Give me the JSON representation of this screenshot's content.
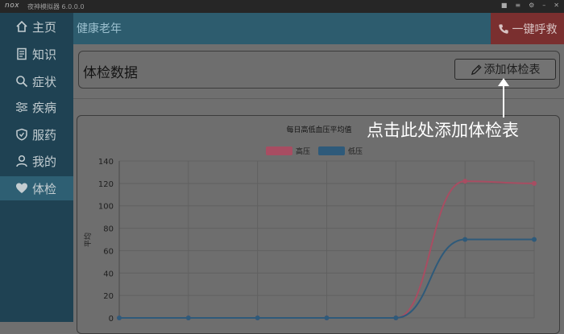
{
  "window": {
    "logo": "nox",
    "title": "夜神模拟器 6.0.0.0"
  },
  "sidebar": {
    "items": [
      {
        "label": "主页",
        "icon": "home-icon"
      },
      {
        "label": "知识",
        "icon": "document-icon"
      },
      {
        "label": "症状",
        "icon": "search-icon"
      },
      {
        "label": "疾病",
        "icon": "sliders-icon"
      },
      {
        "label": "服药",
        "icon": "shield-icon"
      },
      {
        "label": "我的",
        "icon": "user-icon"
      },
      {
        "label": "体检",
        "icon": "heart-icon"
      }
    ],
    "active_index": 6
  },
  "header": {
    "title": "健康老年",
    "sos_label": "一键呼救"
  },
  "panel": {
    "title": "体检数据",
    "add_button": "添加体检表"
  },
  "callout": {
    "text": "点击此处添加体检表"
  },
  "colors": {
    "high": "#a84d62",
    "low": "#2e5a7a",
    "sidebar": "#1f4253",
    "header": "#2d5c6e",
    "sos": "#7a2f2f"
  },
  "chart_data": {
    "type": "line",
    "title": "每日高低血压平均值",
    "ylabel": "平均",
    "ylim": [
      0,
      140
    ],
    "yticks": [
      0,
      20,
      40,
      60,
      80,
      100,
      120,
      140
    ],
    "series": [
      {
        "name": "高压",
        "values": [
          0,
          0,
          0,
          0,
          0,
          122,
          120
        ]
      },
      {
        "name": "低压",
        "values": [
          0,
          0,
          0,
          0,
          0,
          70,
          70
        ]
      }
    ],
    "legend": "top-center",
    "grid": true
  }
}
